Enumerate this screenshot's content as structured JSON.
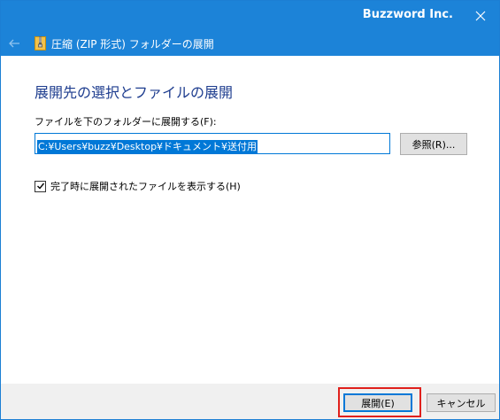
{
  "titlebar": {
    "title": "Buzzword Inc.",
    "close_icon": "close-icon"
  },
  "header": {
    "back_icon": "back-arrow-icon",
    "zip_icon": "zip-folder-icon",
    "title": "圧縮 (ZIP 形式) フォルダーの展開"
  },
  "main": {
    "heading": "展開先の選択とファイルの展開",
    "field_label": "ファイルを下のフォルダーに展開する(F):",
    "path_value": "C:¥Users¥buzz¥Desktop¥ドキュメント¥送付用",
    "browse_label": "参照(R)...",
    "checkbox_label": "完了時に展開されたファイルを表示する(H)",
    "checkbox_checked": true
  },
  "footer": {
    "extract_label": "展開(E)",
    "cancel_label": "キャンセル"
  },
  "colors": {
    "accent": "#1c83d8",
    "heading": "#1e3d8f",
    "selection": "#0078d7",
    "highlight": "#e0201c"
  }
}
